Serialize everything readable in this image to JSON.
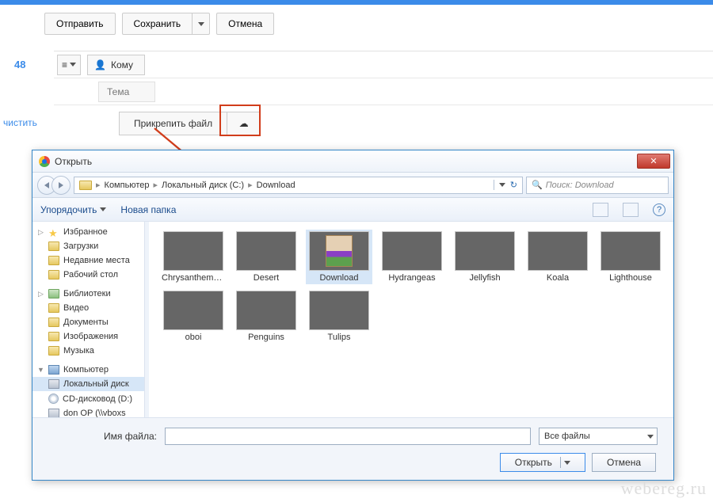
{
  "compose": {
    "send": "Отправить",
    "save": "Сохранить",
    "cancel": "Отмена",
    "sidebar_count": "48",
    "clear_link": "чистить",
    "to_label": "Кому",
    "subject": "Тема",
    "attach": "Прикрепить файл"
  },
  "dialog": {
    "title": "Открыть",
    "breadcrumb": [
      "Компьютер",
      "Локальный диск (C:)",
      "Download"
    ],
    "search_placeholder": "Поиск: Download",
    "organize": "Упорядочить",
    "new_folder": "Новая папка",
    "filename_label": "Имя файла:",
    "filename_value": "",
    "filter": "Все файлы",
    "open_btn": "Открыть",
    "cancel_btn": "Отмена",
    "tree": {
      "favorites": "Избранное",
      "downloads": "Загрузки",
      "recent": "Недавние места",
      "desktop": "Рабочий стол",
      "libraries": "Библиотеки",
      "video": "Видео",
      "documents": "Документы",
      "pictures": "Изображения",
      "music": "Музыка",
      "computer": "Компьютер",
      "local_disk": "Локальный диск",
      "cd_drive": "CD-дисковод (D:)",
      "don_op": "don OP (\\\\vboxs"
    },
    "files": [
      {
        "name": "Chrysanthemum",
        "kind": "image",
        "cls": "th-chrys"
      },
      {
        "name": "Desert",
        "kind": "image",
        "cls": "th-desert"
      },
      {
        "name": "Download",
        "kind": "archive"
      },
      {
        "name": "Hydrangeas",
        "kind": "image",
        "cls": "th-hydr"
      },
      {
        "name": "Jellyfish",
        "kind": "image",
        "cls": "th-jelly"
      },
      {
        "name": "Koala",
        "kind": "image",
        "cls": "th-koala"
      },
      {
        "name": "Lighthouse",
        "kind": "image",
        "cls": "th-light"
      },
      {
        "name": "oboi",
        "kind": "image",
        "cls": "th-oboi"
      },
      {
        "name": "Penguins",
        "kind": "image",
        "cls": "th-peng"
      },
      {
        "name": "Tulips",
        "kind": "image",
        "cls": "th-tulip"
      }
    ]
  },
  "watermark": "webereg.ru"
}
